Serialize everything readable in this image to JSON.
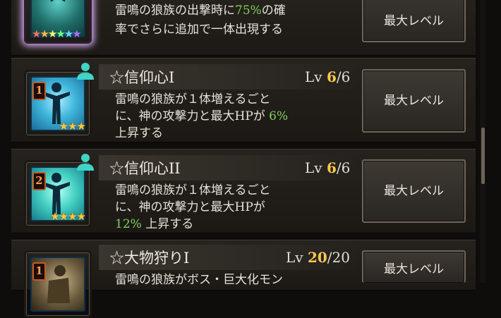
{
  "colors": {
    "accent_green": "#7ed15a",
    "level_gold": "#f6c84d",
    "star_gold": "#ffc83a"
  },
  "top_item": {
    "desc_lines": [
      {
        "pre": "雷鳴の狼族の出撃時に",
        "val": "75%",
        "post": "の確"
      },
      {
        "pre": "率でさらに追加で一体出現する",
        "val": "",
        "post": ""
      }
    ],
    "button_label": "最大レベル"
  },
  "skills": [
    {
      "title": "☆信仰心I",
      "lv_prefix": "Lv",
      "lv_current": "6",
      "lv_max": "/6",
      "rank": "1",
      "stars": "★★★",
      "card_icon": "person-arms-spread-icon",
      "badge_icon": "person-icon",
      "desc_line1": "雷鳴の狼族が１体増えるごと",
      "desc_line2_pre": "に、神の攻撃力と最大HPが ",
      "desc_line2_val": "6%",
      "desc_line3_val": "",
      "desc_line3_post": "上昇する",
      "button_label": "最大レベル"
    },
    {
      "title": "☆信仰心II",
      "lv_prefix": "Lv",
      "lv_current": "6",
      "lv_max": "/6",
      "rank": "2",
      "stars": "★★★★",
      "card_icon": "person-arms-spread-icon",
      "badge_icon": "person-icon",
      "desc_line1": "雷鳴の狼族が１体増えるごと",
      "desc_line2_pre": "に、神の攻撃力と最大HPが",
      "desc_line2_val": "",
      "desc_line3_val": "12%",
      "desc_line3_post": " 上昇する",
      "button_label": "最大レベル"
    },
    {
      "title": "☆大物狩りI",
      "lv_prefix": "Lv",
      "lv_current": "20",
      "lv_max": "/20",
      "rank": "1",
      "card_icon": "hunter-icon",
      "desc_line1": "雷鳴の狼族がボス・巨大化モン",
      "button_label": "最大レベル"
    }
  ]
}
